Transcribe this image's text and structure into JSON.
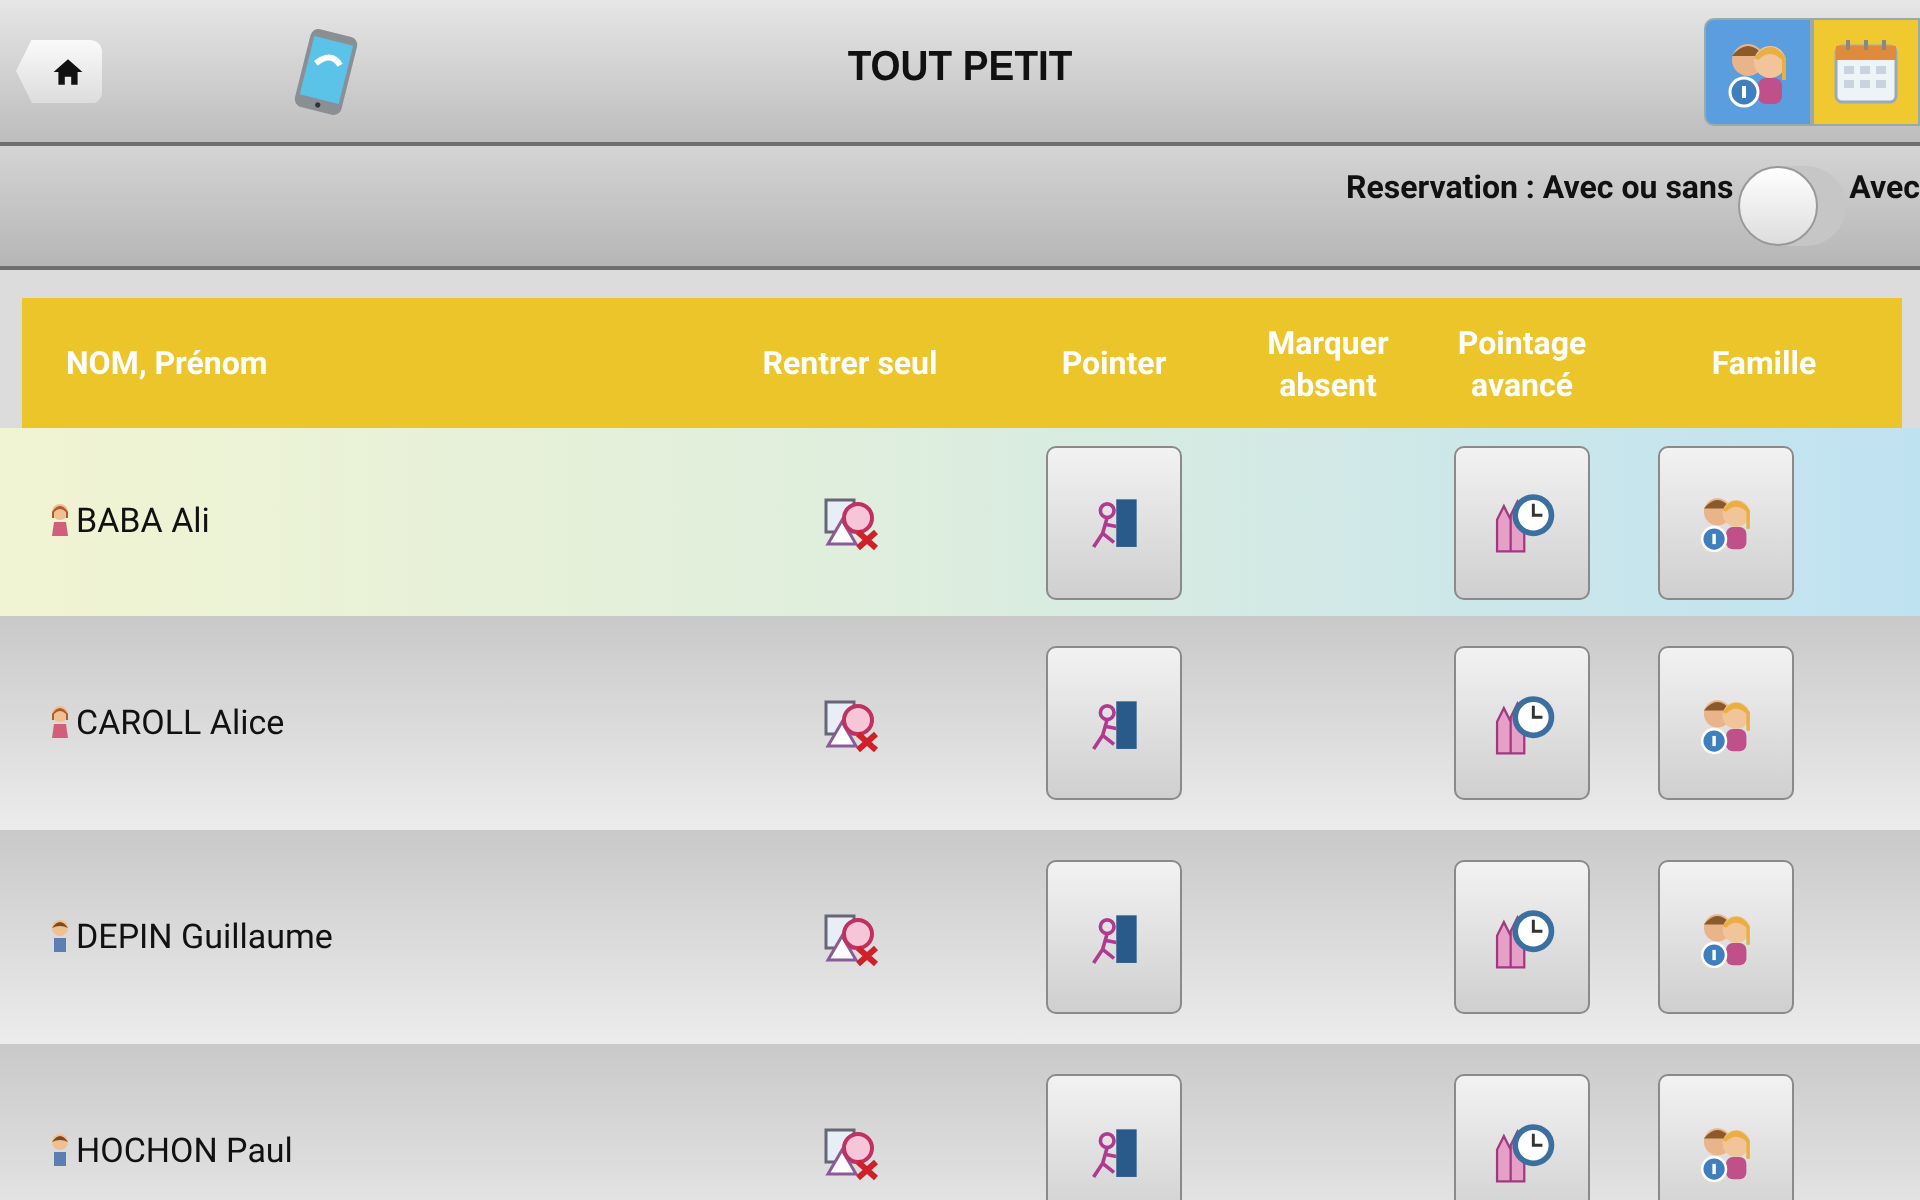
{
  "header": {
    "title": "TOUT PETIT",
    "view_tabs": [
      {
        "kind": "family",
        "selected": true
      },
      {
        "kind": "calendar",
        "selected": false
      }
    ]
  },
  "reservation_bar": {
    "label": "Reservation : Avec ou sans",
    "toggle": {
      "on": false
    },
    "option_label": "Avec"
  },
  "table": {
    "columns": [
      "NOM, Prénom",
      "Rentrer seul",
      "Pointer",
      "Marquer\nabsent",
      "Pointage\navancé",
      "Famille"
    ],
    "rows": [
      {
        "kind": "girl",
        "name": "BABA Ali"
      },
      {
        "kind": "girl",
        "name": "CAROLL Alice"
      },
      {
        "kind": "boy",
        "name": "DEPIN Guillaume"
      },
      {
        "kind": "boy",
        "name": "HOCHON Paul"
      }
    ]
  }
}
